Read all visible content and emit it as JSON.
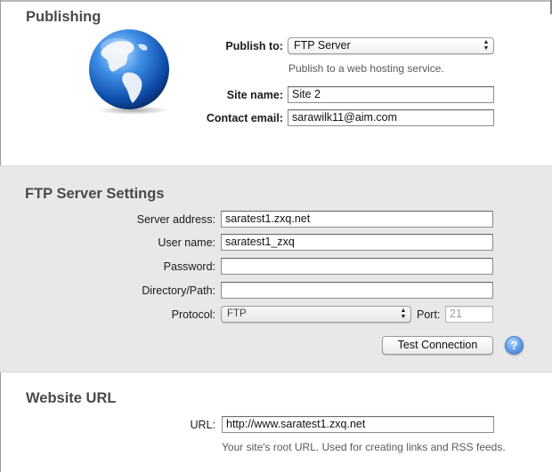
{
  "publishing": {
    "title": "Publishing",
    "publish_to_label": "Publish to:",
    "publish_to_value": "FTP Server",
    "publish_to_description": "Publish to a web hosting service.",
    "site_name_label": "Site name:",
    "site_name_value": "Site 2",
    "contact_email_label": "Contact email:",
    "contact_email_value": "sarawilk11@aim.com",
    "icon": "globe-icon"
  },
  "ftp": {
    "title": "FTP Server Settings",
    "server_address_label": "Server address:",
    "server_address_value": "saratest1.zxq.net",
    "user_name_label": "User name:",
    "user_name_value": "saratest1_zxq",
    "password_label": "Password:",
    "password_value": "",
    "directory_label": "Directory/Path:",
    "directory_value": "",
    "protocol_label": "Protocol:",
    "protocol_value": "FTP",
    "port_label": "Port:",
    "port_value": "21",
    "test_button_label": "Test Connection",
    "help_label": "?"
  },
  "website_url": {
    "title": "Website URL",
    "url_label": "URL:",
    "url_value": "http://www.saratest1.zxq.net",
    "url_hint": "Your site's root URL. Used for creating links and RSS feeds."
  },
  "colors": {
    "section_gray": "#e8e8e8",
    "title_text": "#4a4a4a",
    "help_blue": "#5b95e0"
  }
}
